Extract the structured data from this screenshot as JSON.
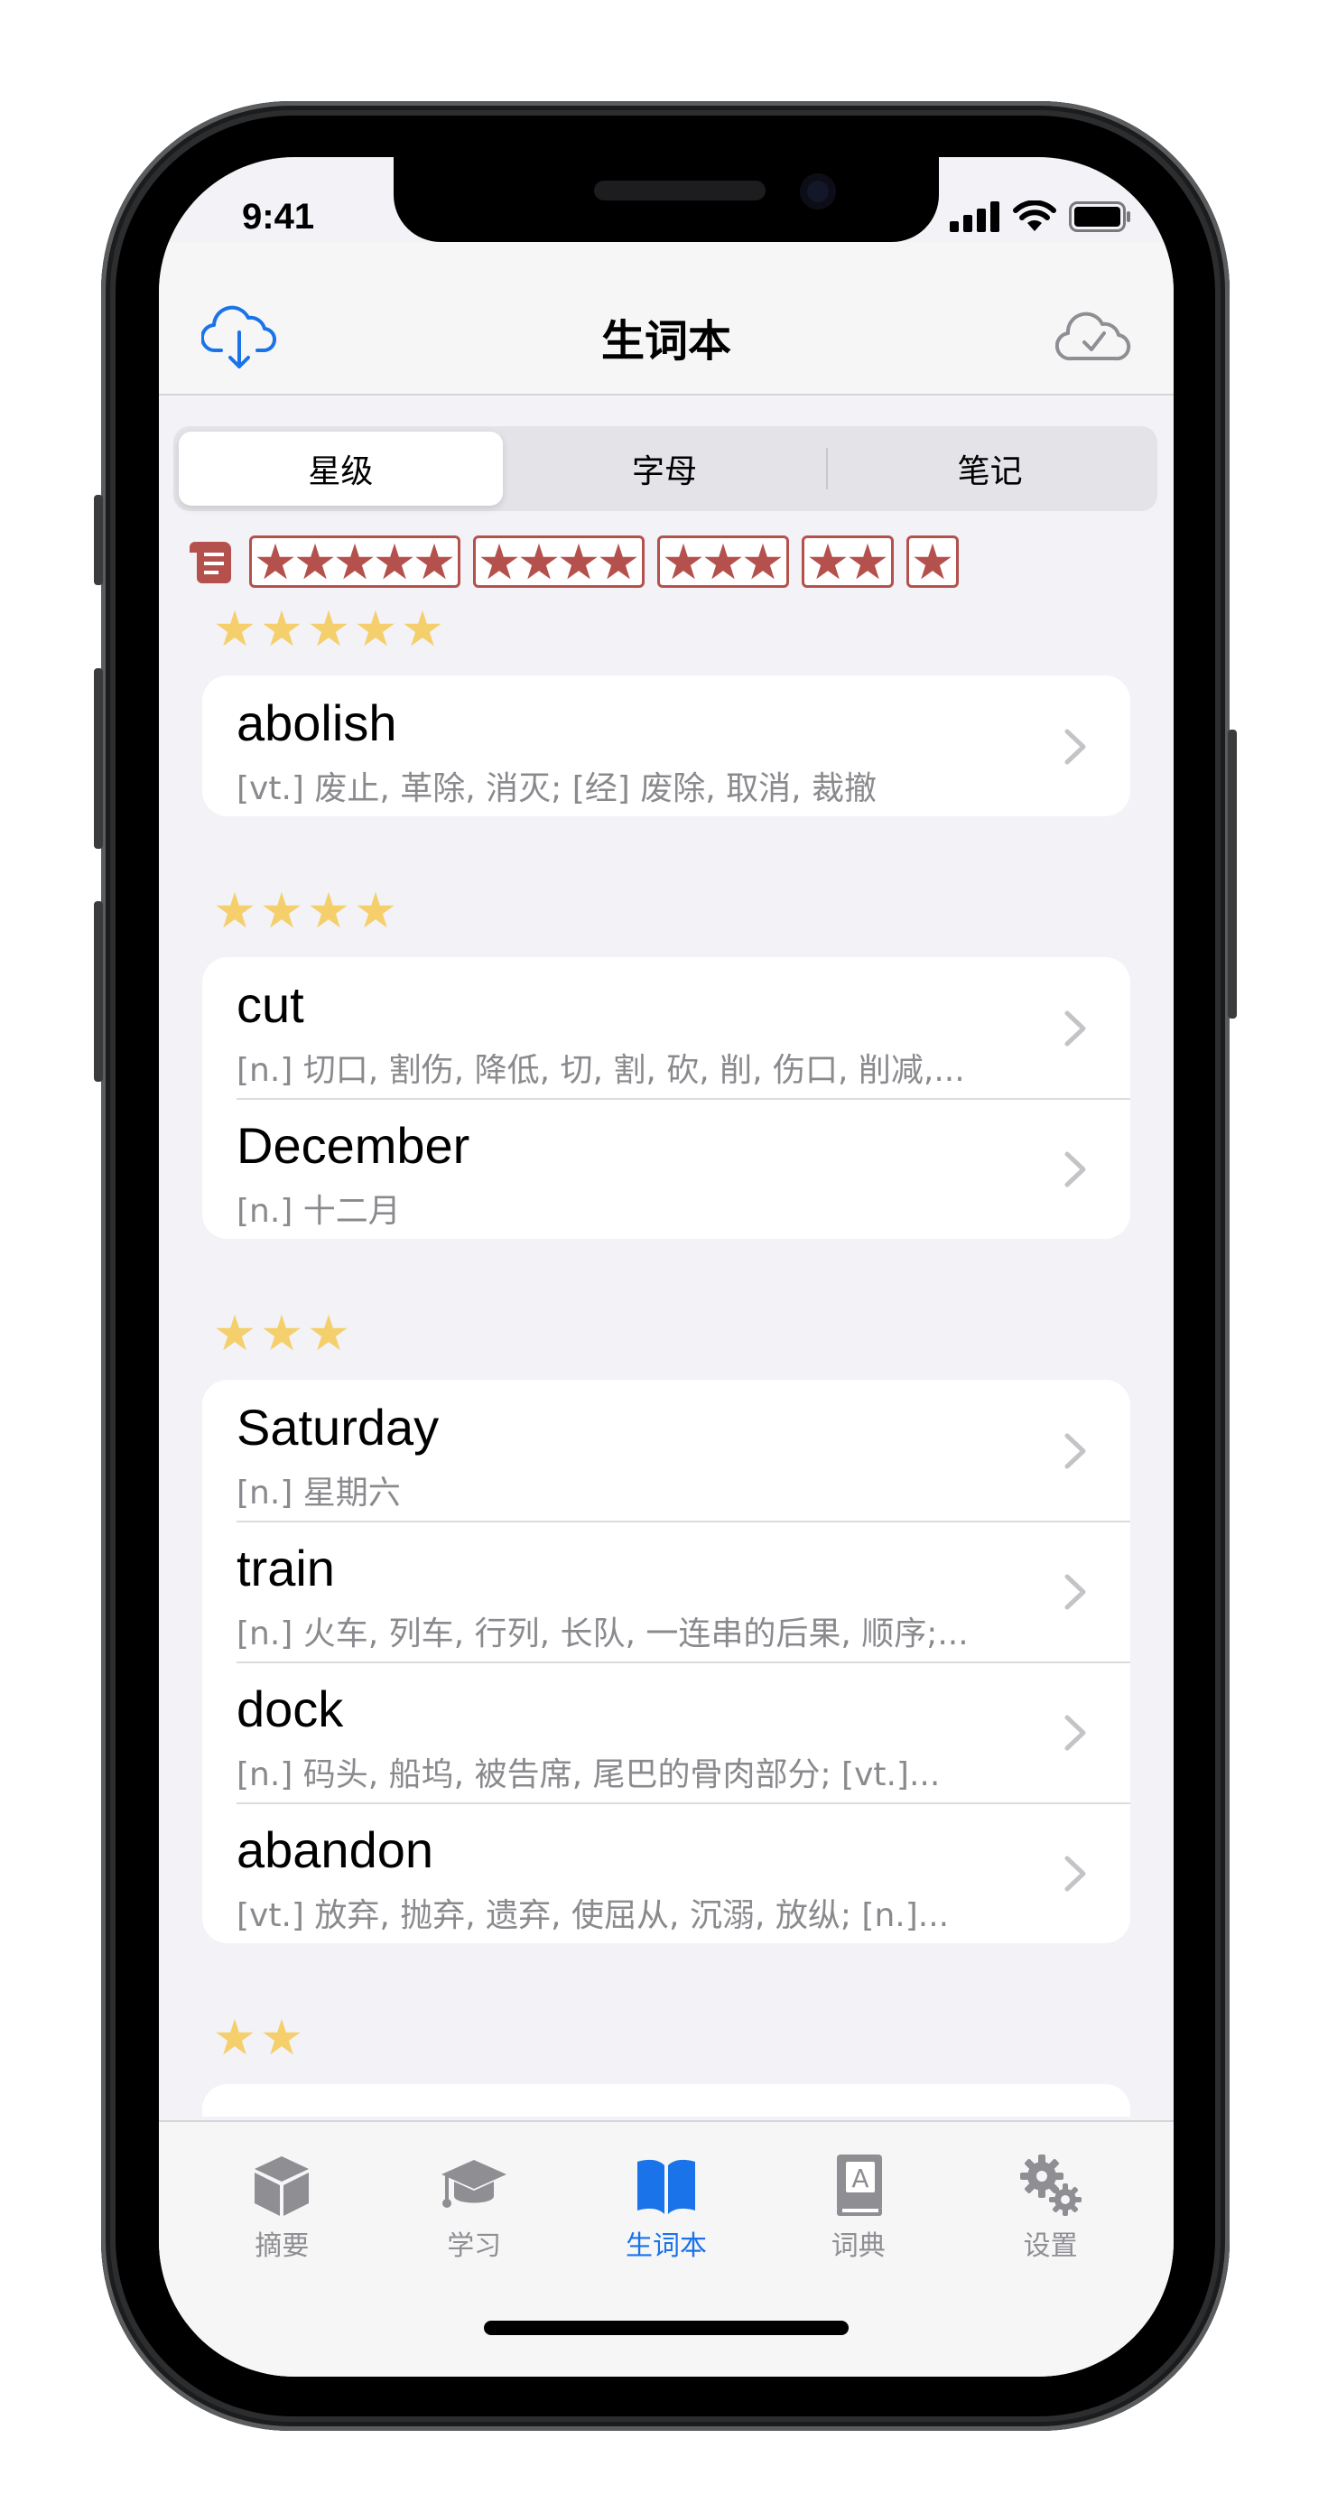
{
  "status_bar": {
    "time": "9:41"
  },
  "nav": {
    "title": "生词本"
  },
  "segments": [
    {
      "label": "星级",
      "active": true
    },
    {
      "label": "字母",
      "active": false
    },
    {
      "label": "笔记",
      "active": false
    }
  ],
  "filter": {
    "chips": [
      5,
      4,
      3,
      2,
      1
    ],
    "color": "#b4514d"
  },
  "sections": [
    {
      "stars": 5,
      "words": [
        {
          "word": "abolish",
          "definition": "[vt.]  废止, 革除, 消灭; [经] 废除, 取消, 裁撤"
        }
      ]
    },
    {
      "stars": 4,
      "words": [
        {
          "word": "cut",
          "definition": "[n.]  切口, 割伤, 降低, 切, 割, 砍, 削, 伤口, 削减,..."
        },
        {
          "word": "December",
          "definition": "[n.]  十二月"
        }
      ]
    },
    {
      "stars": 3,
      "words": [
        {
          "word": "Saturday",
          "definition": "[n.]  星期六"
        },
        {
          "word": "train",
          "definition": "[n.]  火车, 列车, 行列, 长队, 一连串的后果, 顺序;..."
        },
        {
          "word": "dock",
          "definition": "[n.]  码头, 船坞, 被告席, 尾巴的骨肉部分; [vt.]..."
        },
        {
          "word": "abandon",
          "definition": "[vt.]  放弃, 抛弃, 遗弃, 使屈从, 沉溺, 放纵; [n.]..."
        }
      ]
    },
    {
      "stars": 2,
      "words": []
    }
  ],
  "tabs": [
    {
      "label": "摘要",
      "icon": "cube-icon",
      "active": false
    },
    {
      "label": "学习",
      "icon": "graduation-cap-icon",
      "active": false
    },
    {
      "label": "生词本",
      "icon": "open-book-icon",
      "active": true
    },
    {
      "label": "词典",
      "icon": "dictionary-icon",
      "active": false
    },
    {
      "label": "设置",
      "icon": "gears-icon",
      "active": false
    }
  ],
  "colors": {
    "accent": "#1a73e8",
    "section_star": "#f5cf6b",
    "filter_star": "#b4514d",
    "inactive_tab": "#8e8e93"
  }
}
